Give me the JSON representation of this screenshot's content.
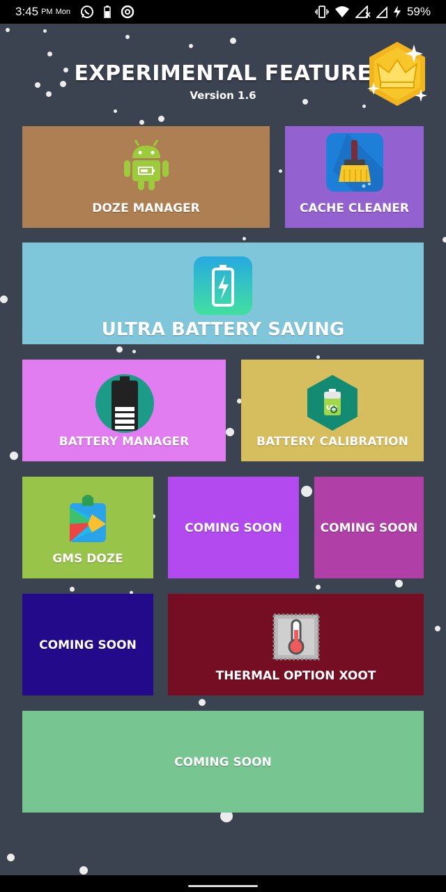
{
  "status_bar": {
    "time": "3:45",
    "ampm": "PM",
    "day": "Mon",
    "battery_percent": "59%",
    "icons": [
      "whatsapp-icon",
      "battery-saver-icon",
      "data-saver-icon",
      "vibrate-icon",
      "wifi-icon",
      "signal-icon",
      "charging-icon"
    ]
  },
  "header": {
    "title": "EXPERIMENTAL FEATURE",
    "version": "Version 1.6",
    "badge_icon": "crown-icon"
  },
  "tiles": {
    "doze_manager": {
      "label": "DOZE MANAGER",
      "icon": "android-battery-icon",
      "color": "#ae7f52"
    },
    "cache_cleaner": {
      "label": "CACHE CLEANER",
      "icon": "broom-icon",
      "color": "#9461d0"
    },
    "ultra_battery": {
      "label": "ULTRA BATTERY SAVING",
      "icon": "battery-bolt-icon",
      "color": "#80c6da"
    },
    "battery_manager": {
      "label": "BATTERY MANAGER",
      "icon": "battery-icon",
      "color": "#e17df0"
    },
    "battery_calibration": {
      "label": "BATTERY CALIBRATION",
      "icon": "battery-hexagon-icon",
      "color": "#d6be5e"
    },
    "gms_doze": {
      "label": "GMS DOZE",
      "icon": "google-play-services-icon",
      "color": "#99c44a"
    },
    "coming_soon_1": {
      "label": "COMING SOON",
      "color": "#b24aef"
    },
    "coming_soon_2": {
      "label": "COMING SOON",
      "color": "#b03fa7"
    },
    "coming_soon_3": {
      "label": "COMING SOON",
      "color": "#230a8a"
    },
    "thermal_option": {
      "label": "THERMAL OPTION XOOT",
      "icon": "thermometer-icon",
      "color": "#750e23"
    },
    "coming_soon_4": {
      "label": "COMING SOON",
      "color": "#77c590"
    }
  }
}
